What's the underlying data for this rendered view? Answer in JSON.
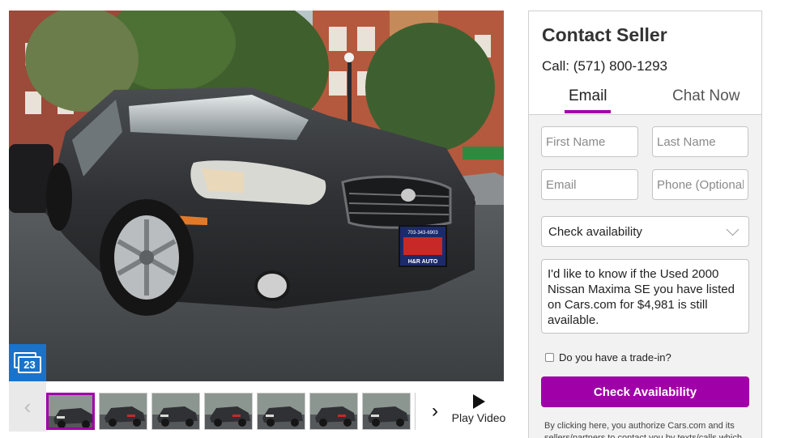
{
  "gallery": {
    "photo_count": "23",
    "thumbnail_count": 8,
    "active_thumbnail": 1,
    "prev_arrow": "‹",
    "next_arrow": "›",
    "play_video_label": "Play Video",
    "plate_line1": "703-343-6903",
    "plate_line2": "H&R AUTO"
  },
  "contact": {
    "title": "Contact Seller",
    "call_label": "Call: (571) 800-1293",
    "tabs": [
      {
        "label": "Email",
        "active": true
      },
      {
        "label": "Chat Now",
        "active": false
      }
    ],
    "fields": {
      "first_name_placeholder": "First Name",
      "last_name_placeholder": "Last Name",
      "email_placeholder": "Email",
      "phone_placeholder": "Phone (Optional)"
    },
    "request_type": "Check availability",
    "message": "I'd like to know if the Used 2000 Nissan Maxima SE you have listed on Cars.com for $4,981 is still available.",
    "tradein_label": "Do you have a trade-in?",
    "tradein_checked": false,
    "submit_label": "Check Availability",
    "disclaimer": "By clicking here, you authorize Cars.com and its sellers/partners to contact you by texts/calls which"
  },
  "colors": {
    "accent": "#a000a8",
    "photo_badge": "#1a73c9"
  }
}
